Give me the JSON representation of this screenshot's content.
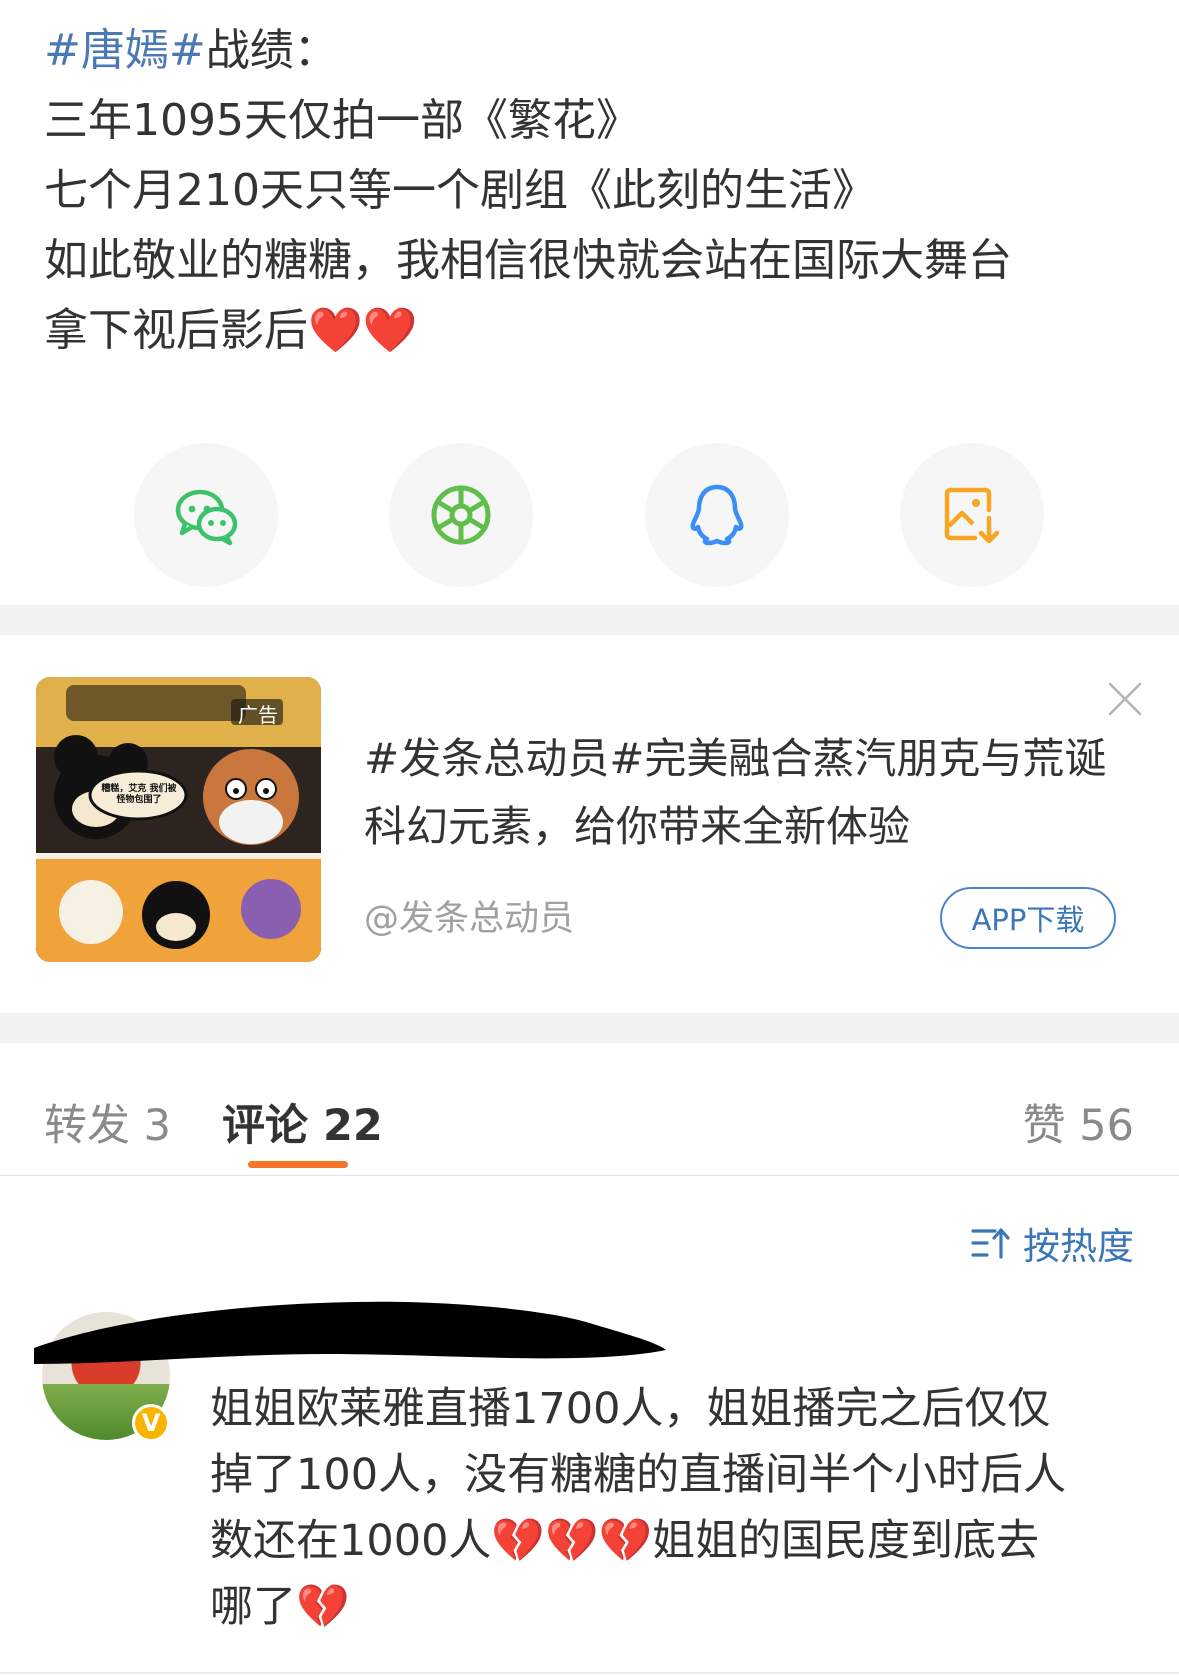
{
  "post": {
    "lines": [
      {
        "topic": "#唐嫣#",
        "text": "战绩："
      },
      {
        "text": "三年1095天仅拍一部《繁花》"
      },
      {
        "text": "七个月210天只等一个剧组《此刻的生活》"
      },
      {
        "text": "如此敬业的糖糖，我相信很快就会站在国际大舞台"
      },
      {
        "text": "拿下视后影后",
        "emoji": "❤️❤️"
      }
    ]
  },
  "share": {
    "icons": [
      "wechat-icon",
      "moments-icon",
      "qq-icon",
      "save-image-icon"
    ],
    "colors": {
      "wechat": "#3bc26b",
      "moments": "#5fbf4a",
      "qq": "#3a8ef5",
      "save": "#f6a623"
    }
  },
  "ad": {
    "image_badge": "广告",
    "image_bubble": "糟糕，艾克 我们被怪物包围了",
    "title_topic": "#发条总动员#",
    "title_text": "完美融合蒸汽朋克与荒诞科幻元素，给你带来全新体验",
    "source": "@发条总动员",
    "button": "APP下载"
  },
  "tabs": {
    "repost": {
      "label": "转发",
      "count": "3"
    },
    "comment": {
      "label": "评论",
      "count": "22"
    },
    "like": {
      "label": "赞",
      "count": "56"
    }
  },
  "sort": {
    "label": "按热度"
  },
  "comment": {
    "verified_badge": "V",
    "lines": [
      "姐姐欧莱雅直播1700人，姐姐播完之后仅仅",
      "掉了100人，没有糖糖的直播间半个小时后人",
      "数还在1000人💔💔💔姐姐的国民度到底去",
      "哪了💔"
    ]
  },
  "theme": {
    "accent": "#f5742a",
    "link": "#4b79b4",
    "button_blue": "#3b76b8"
  }
}
